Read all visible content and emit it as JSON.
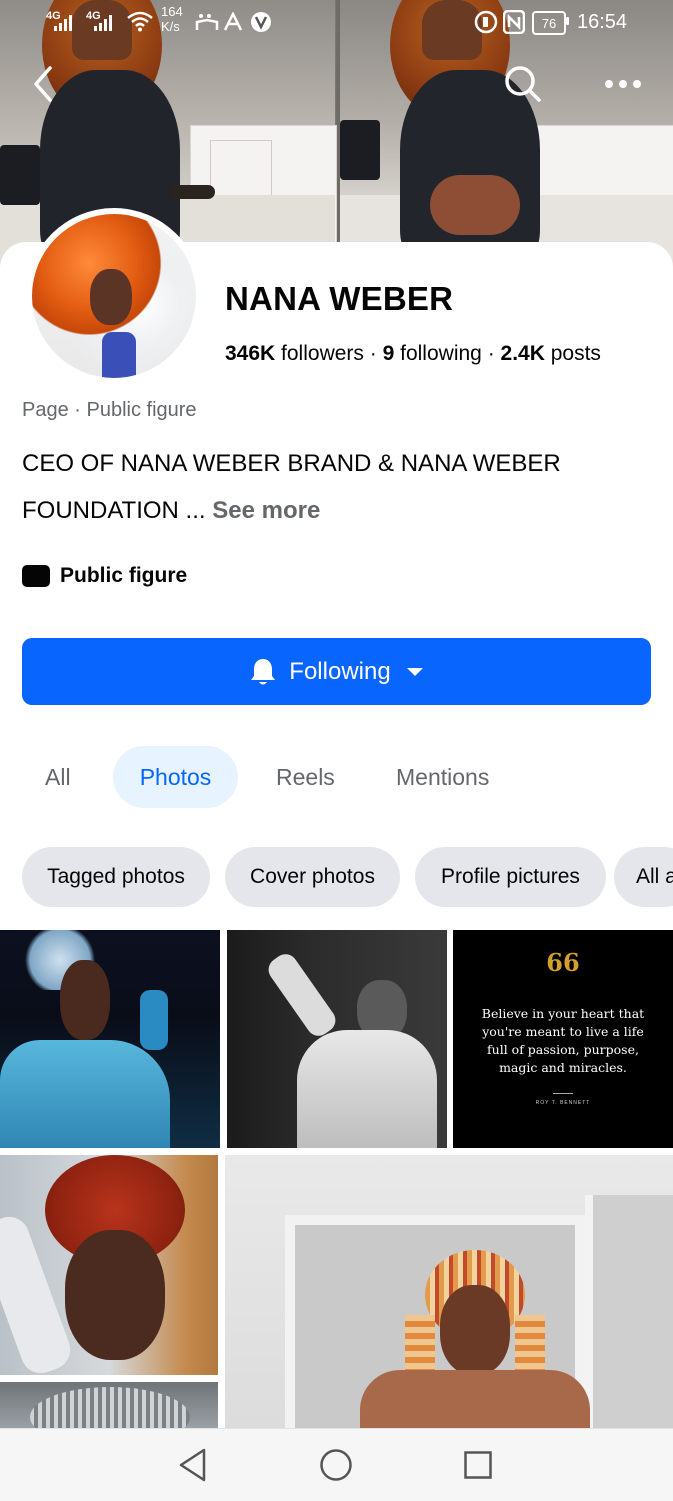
{
  "status_bar": {
    "signal1": "4G",
    "signal2": "4G",
    "net_speed": "164",
    "net_unit": "K/s",
    "battery": "76",
    "time": "16:54"
  },
  "header": {
    "back_icon": "chevron-left-icon",
    "search_icon": "search-icon",
    "more_icon": "more-horizontal-icon"
  },
  "profile": {
    "name": "NANA WEBER",
    "followers_count": "346K",
    "followers_label": "followers",
    "following_count": "9",
    "following_label": "following",
    "posts_count": "2.4K",
    "posts_label": "posts",
    "category": "Page · Public figure",
    "bio_line1": "CEO OF NANA WEBER BRAND & NANA WEBER",
    "bio_line2": "FOUNDATION ...",
    "see_more": "See more",
    "tag_label": "Public figure"
  },
  "follow_button": {
    "label": "Following"
  },
  "tabs": [
    {
      "label": "All"
    },
    {
      "label": "Photos"
    },
    {
      "label": "Reels"
    },
    {
      "label": "Mentions"
    }
  ],
  "chips": [
    {
      "label": "Tagged photos"
    },
    {
      "label": "Cover photos"
    },
    {
      "label": "Profile pictures"
    },
    {
      "label": "All a"
    }
  ],
  "quote": {
    "mark": "66",
    "text": "Believe in your heart that you're meant to live a life full of passion, purpose, magic and miracles.",
    "author": "ROY T. BENNETT"
  },
  "colors": {
    "accent": "#0866ff",
    "active_tab_bg": "#e7f3ff",
    "chip_bg": "#e4e6eb"
  }
}
